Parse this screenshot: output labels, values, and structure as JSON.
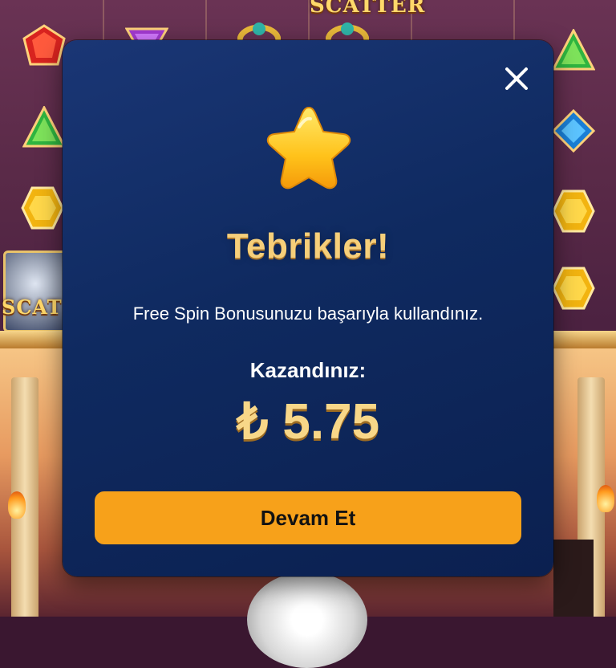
{
  "background": {
    "scatter_label": "SCATTER",
    "scatter_label_partial": "SCAT"
  },
  "modal": {
    "close_icon": "close-icon",
    "star_icon": "star-icon",
    "title": "Tebrikler!",
    "message": "Free Spin Bonusunuzu başarıyla kullandınız.",
    "won_label": "Kazandınız:",
    "currency_symbol": "₺",
    "amount": "5.75",
    "continue_label": "Devam Et"
  },
  "colors": {
    "modal_bg": "#0f2a60",
    "accent_gold": "#f6cf7a",
    "button_orange": "#f7a11a"
  }
}
